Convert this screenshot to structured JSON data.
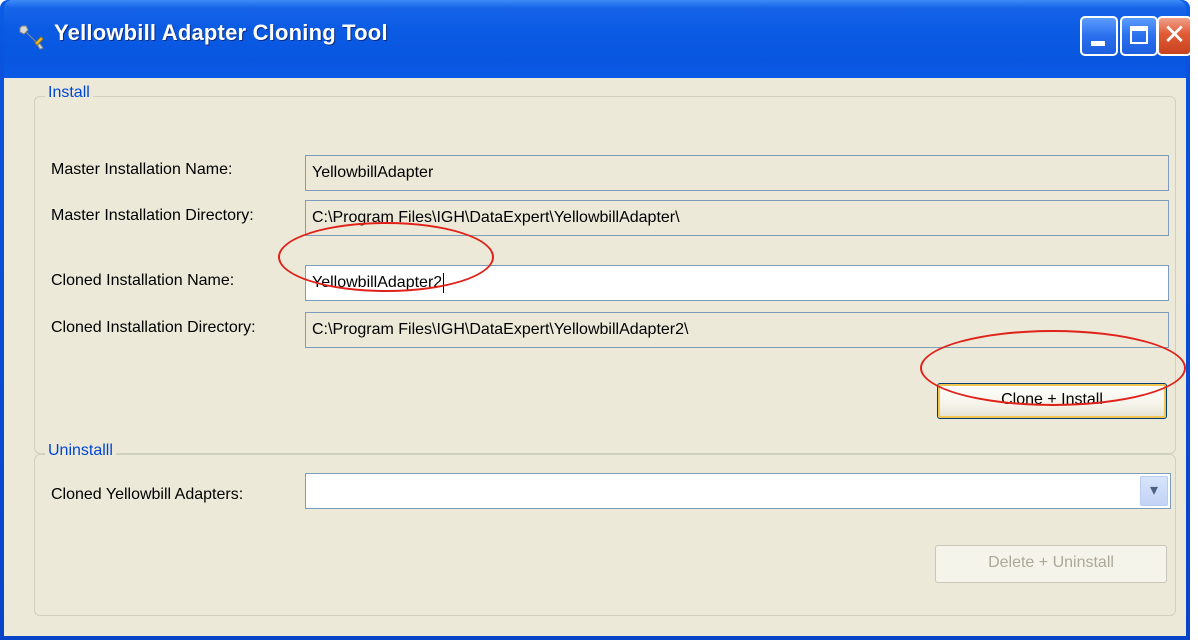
{
  "window": {
    "title": "Yellowbill Adapter Cloning Tool",
    "icons": {
      "app": "wrench-icon",
      "minimize": "minimize-icon",
      "maximize": "maximize-icon",
      "close": "close-icon"
    },
    "close_glyph": "✕"
  },
  "install": {
    "group_label": "Install",
    "master_name_label": "Master Installation Name:",
    "master_name_value": "YellowbillAdapter",
    "master_dir_label": "Master Installation Directory:",
    "master_dir_value": "C:\\Program Files\\IGH\\DataExpert\\YellowbillAdapter\\",
    "cloned_name_label": "Cloned Installation Name:",
    "cloned_name_value": "YellowbillAdapter2",
    "cloned_dir_label": "Cloned Installation Directory:",
    "cloned_dir_value": "C:\\Program Files\\IGH\\DataExpert\\YellowbillAdapter2\\",
    "clone_button_label": "Clone + Install"
  },
  "uninstall": {
    "group_label": "Uninstalll",
    "adapters_label": "Cloned Yellowbill Adapters:",
    "adapters_selected": "",
    "dropdown_glyph": "▾",
    "delete_button_label": "Delete + Uninstall"
  },
  "colors": {
    "titlebar": "#0a5ae3",
    "client_bg": "#ece9d8",
    "group_label": "#0046d5",
    "annotation_red": "#e0221a",
    "button_focus": "#f0c650"
  }
}
